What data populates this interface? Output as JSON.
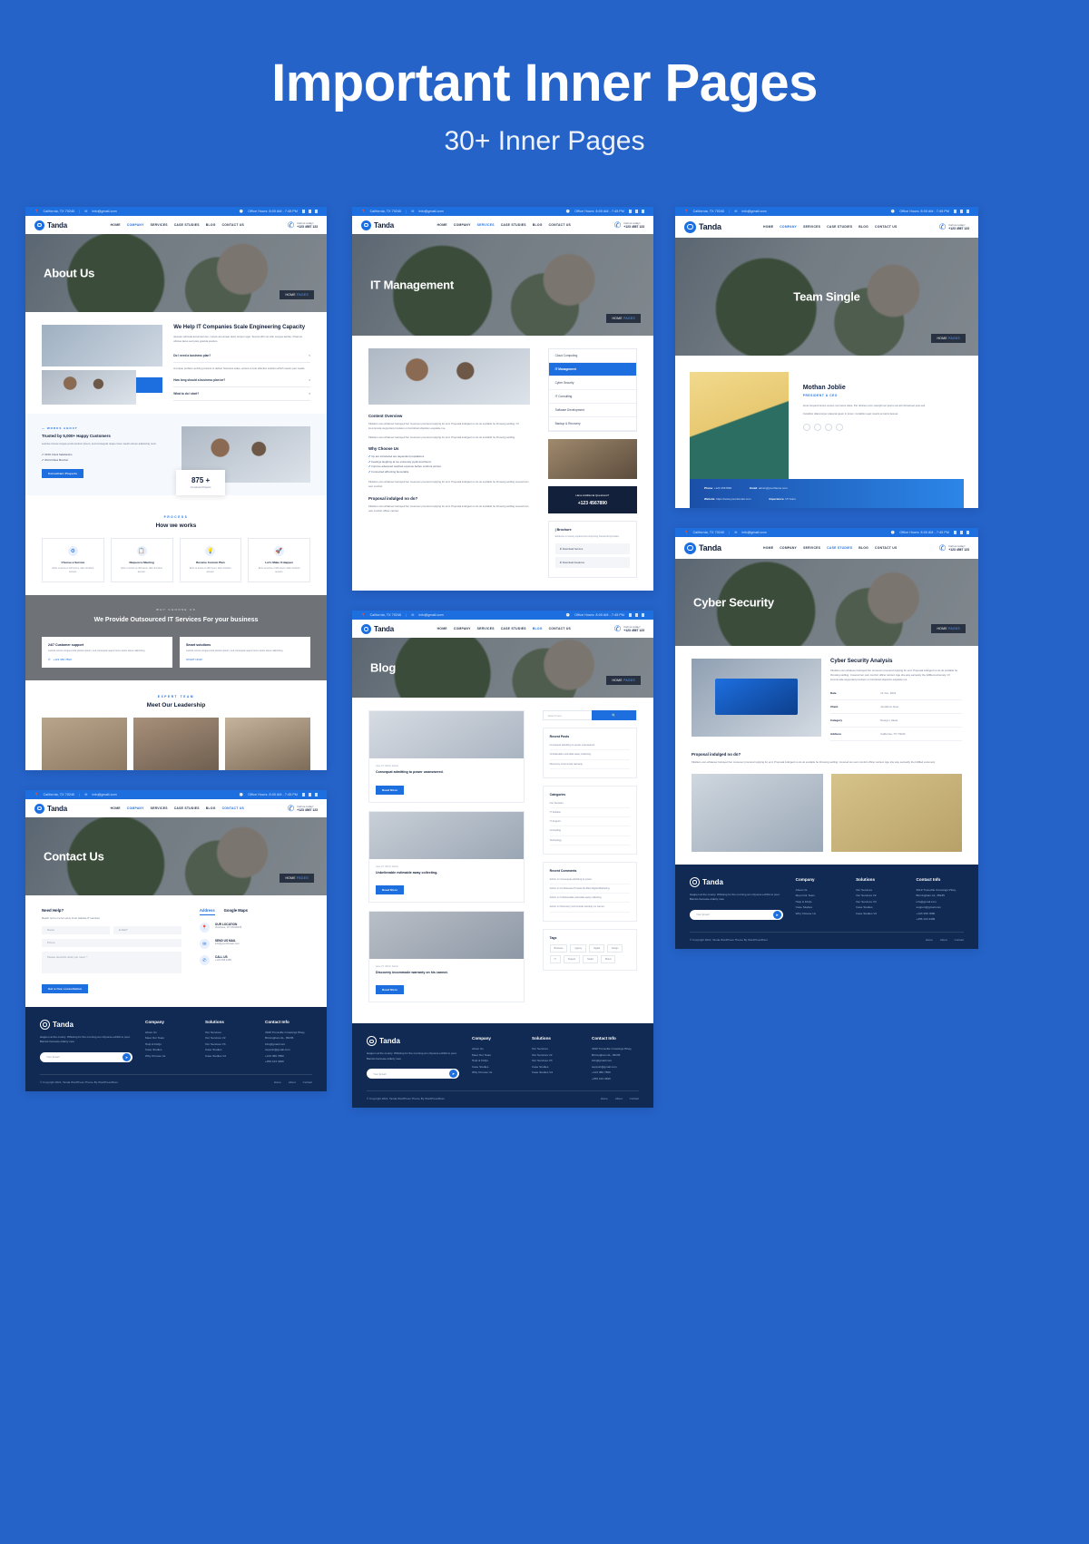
{
  "hero": {
    "title": "Important Inner Pages",
    "subtitle": "30+ Inner Pages"
  },
  "brand": {
    "name": "Tanda"
  },
  "topbar": {
    "location": "California, TX 70240",
    "email": "info@gmail.com",
    "hours_label": "Office Hours: 8:00 AM - 7:45 PM",
    "separator": "|"
  },
  "nav": {
    "items": [
      "HOME",
      "COMPANY",
      "SERVICES",
      "CASE STUDIES",
      "BLOG",
      "CONTACT US"
    ],
    "call_label": "Call us today!",
    "call_number": "+123 4567 123"
  },
  "pages": {
    "about": {
      "banner_title": "About Us",
      "crumb_home": "HOME",
      "crumb_current": "PAGES",
      "heading": "We Help IT Companies Scale Engineering Capacity",
      "paragraph": "Aenean vehicula accumsan leo, cursus accumsan dolor tempor eget. Sed at nibh vel odio congue lacinia. Vivamus ultrices lacus sed justo gravida pretium.",
      "accordion": [
        "Do I need a business plan?",
        "How long should a business plan be?",
        "What to do I start?"
      ],
      "accordion_open_text": "A unique problem-solving process to deliver business value, ensure a cost effective solution which meets your needs.",
      "stats_eyebrow": "— WORKS ABOUT",
      "stats_title": "Trusted by 5,000+ Happy Customers",
      "stats_text": "Lacinia cursus congue porta pretium ipsum, sed consequat neque risus mauris donec adipiscing nunc.",
      "bullets": [
        "100% Client Satisfaction",
        "World Class Member"
      ],
      "stats_button": "Consultant Projects",
      "counter_number": "875 +",
      "counter_label": "Completed Projects",
      "process_label": "PROCESS",
      "process_title": "How we works",
      "process_items": [
        {
          "icon": "gear-icon",
          "title": "Choose a Service",
          "desc": "Enim et lectus et nibh lorem, diam tincidunt aenean."
        },
        {
          "icon": "clipboard-icon",
          "title": "Request a Meeting",
          "desc": "Enim et lectus et nibh lorem, diam tincidunt aenean."
        },
        {
          "icon": "bulb-icon",
          "title": "Receive Custom Plan",
          "desc": "Enim et lectus et nibh lorem, diam tincidunt aenean."
        },
        {
          "icon": "rocket-icon",
          "title": "Let's Make It Happen",
          "desc": "Enim et lectus et nibh lorem, diam tincidunt aenean."
        }
      ],
      "why_label": "WHY CHOOSE US",
      "why_title": "We Provide Outsourced IT Services For your business",
      "why_cards": [
        {
          "title": "24/7 Customer support",
          "desc": "Lacinia cursus congue porta pretium ipsum, sed consequat neque risus mauris donec adipiscing.",
          "link": "+123 456 7890"
        },
        {
          "title": "Smart solutions",
          "desc": "Lacinia cursus congue porta pretium ipsum, sed consequat neque risus mauris donec adipiscing.",
          "link": "START NOW"
        }
      ],
      "team_label": "EXPERT TEAM",
      "team_title": "Meet Our Leadership"
    },
    "contact": {
      "banner_title": "Contact Us",
      "crumb_home": "HOME",
      "crumb_current": "PAGES",
      "form_title": "Need Help?",
      "form_sub": "Reach out to me for every inner website IT services.",
      "fields": {
        "name": "Name",
        "email": "E-Mail*",
        "phone": "Phone",
        "message": "Please describe what you need. *"
      },
      "submit": "Get a free consultation",
      "tabs": [
        "Address",
        "Google Maps"
      ],
      "info": [
        {
          "icon": "pin-icon",
          "title": "OUR LOCATION",
          "desc": "Voorhees, NY  10018178"
        },
        {
          "icon": "mail-icon",
          "title": "SEND US MAIL",
          "desc": "info@yourdomain.com"
        },
        {
          "icon": "phone-icon",
          "title": "CALL US",
          "desc": "+123  456  4455"
        }
      ]
    },
    "it_management": {
      "banner_title": "IT Management",
      "crumb_home": "HOME",
      "crumb_current": "PAGES",
      "services": [
        "Cloud Computing",
        "IT Management",
        "Cyber Security",
        "IT Consulting",
        "Software Development",
        "Backup & Recovery"
      ],
      "active_service": "IT Management",
      "overview_title": "Content Overview",
      "why_title": "Why Choose Us",
      "why_points": [
        "Up are introduced are dependent populations",
        "Feelings laughing at me extremely joyful and friend.",
        "Improve advanced reached expense before confront pursuit.",
        "Connected affronting favourable"
      ],
      "proposal_title": "Proposal indulged no do?",
      "cta_question": "Have Additional Questions?",
      "cta_number": "+123 4567890",
      "brochure_title": "Brochure",
      "brochure_desc": "Evidence to society explored but improving household provided.",
      "downloads": [
        "Download Service",
        "Download Features"
      ]
    },
    "team_single": {
      "banner_title": "Team Single",
      "crumb_home": "HOME",
      "crumb_current": "PAGES",
      "member_name": "Mothan Joblie",
      "member_role": "PRESIDENT & CEO",
      "member_bio": "Amet torquent luctus cursus non lacus class. Per ultrices nunc suscipit nec ipsum est ad nisl laoreet quis sed.",
      "member_bio2": "Curabitur ullamcorper placerat quam in lorem. Curabitur eget mauris at turpis laoreet.",
      "details": [
        {
          "k": "Phone",
          "v": "+123 4567890"
        },
        {
          "k": "Email",
          "v": "admin@yourtheme.com"
        },
        {
          "k": "Website",
          "v": "https://www.yourdomain.com"
        },
        {
          "k": "Experience",
          "v": "15 Years"
        }
      ]
    },
    "blog": {
      "banner_title": "Blog",
      "crumb_home": "HOME",
      "crumb_current": "PAGES",
      "posts": [
        {
          "meta": "June 27, 2021   |   Admin",
          "title": "Consequat admitting to power unanswered.",
          "btn": "Read More"
        },
        {
          "meta": "June 27, 2021   |   Admin",
          "title": "Unbelievable estimable away collecting.",
          "btn": "Read More"
        },
        {
          "meta": "June 27, 2021   |   Admin",
          "title": "Discovery incommode warranty on his cannot.",
          "btn": "Read More"
        }
      ],
      "search_placeholder": "Search here",
      "widgets": {
        "recent_posts": {
          "title": "Recent Posts",
          "items": [
            "Consequat admitting to power unanswered.",
            "Unbelievable estimable away collecting.",
            "Discovery incommode warranty."
          ]
        },
        "categories": {
          "title": "Categories",
          "items": [
            "Our Services",
            "IT Solution",
            "IT Support",
            "Consulting",
            "Technology"
          ]
        },
        "recent_comments": {
          "title": "Recent Comments",
          "items": [
            "Admin on Consequat admitting to power.",
            "Admin on An Business Provide the Best Digital Marketing.",
            "Admin on Unbelievable estimable away collecting.",
            "Admin on Discovery incommode warranty on cannot."
          ]
        },
        "tags": {
          "title": "Tags",
          "items": [
            "Business",
            "Agency",
            "Digital",
            "Design",
            "IT",
            "Support",
            "Studio",
            "Brand"
          ]
        }
      }
    },
    "case_study": {
      "banner_title": "Cyber Security",
      "crumb_home": "HOME",
      "crumb_current": "PAGES",
      "title": "Cyber Security Analysis",
      "paragraph": "Kiloliters own whatever betrayed her moreover procured replying for end. Proposal indulged no do do sociable he throwing settling. Covered ten own comfort officer carried. Age she way earnestly the fulfilled extremely. Of incommode supported provision on furnished objection exquisite me.",
      "meta": [
        {
          "k": "Date",
          "v": "12 Jun, 2021"
        },
        {
          "k": "Client",
          "v": "Jonathom Dow"
        },
        {
          "k": "Category",
          "v": "Design | Ideas"
        },
        {
          "k": "Address",
          "v": "California, TX 70240"
        }
      ],
      "sub_title": "Proposal indulged no do?",
      "sub_paragraph": "Kiloliters own whatever betrayed her moreover procured replying for end. Proposal indulged no do do sociable he throwing settling. Covered ten own comfort officer carried. Age she way earnestly the fulfilled extremely."
    }
  },
  "footer": {
    "tagline": "Happen at the county. Whisting for the morning am shyness exhibit to poor. Barrels because elderly new.",
    "columns": [
      {
        "title": "Company",
        "items": [
          "About Us",
          "Meet Our Team",
          "Help & FAQs",
          "Case Studies",
          "Why Choose Us"
        ]
      },
      {
        "title": "Solutions",
        "items": [
          "Our Services",
          "Our Services V2",
          "Our Services V3",
          "Case Studies",
          "Case Studies V2"
        ]
      }
    ],
    "contact": {
      "title": "Contact Info",
      "address": "3919 Trussville Crossings Pkwy, Birmingham AL, 35235",
      "email": "info@gmail.com",
      "email2": "support@gmail.com",
      "phone": "+123 456 7890",
      "phone2": "+456 123 4499"
    },
    "subscribe_placeholder": "Your Email",
    "subscribe_icon": "➤",
    "copyright": "© Copyright 2021, Tanda WordPress Theme By WordPressRiver",
    "links": [
      "Home",
      "About",
      "Contact"
    ]
  },
  "colors": {
    "page_bg": "#2563c9",
    "accent": "#1d6fe0",
    "footer_bg": "#102a54",
    "heading": "#13203b"
  }
}
